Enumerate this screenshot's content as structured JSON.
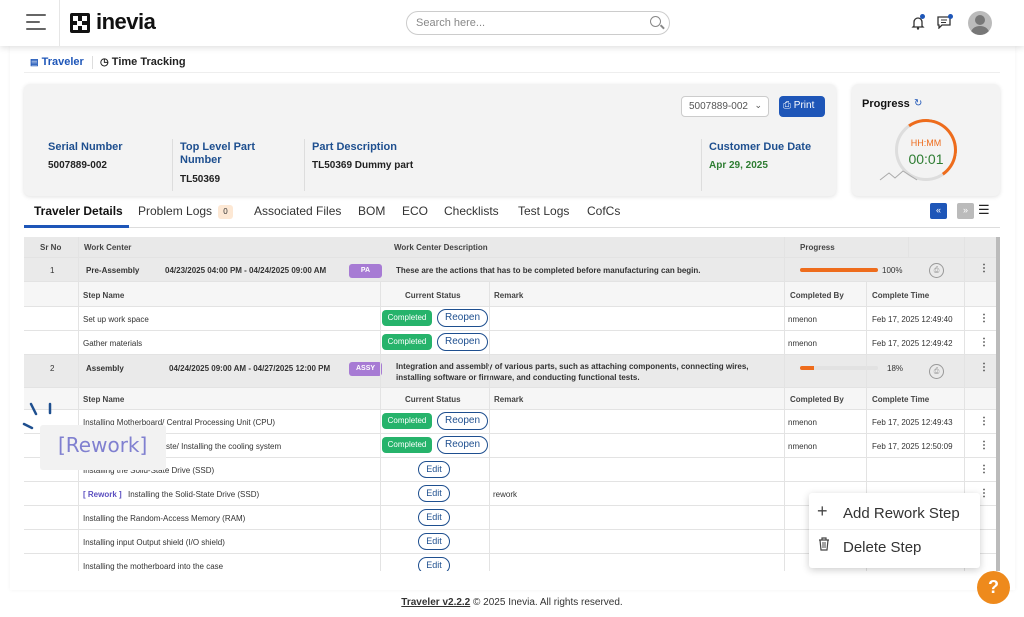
{
  "header": {
    "logo": "inevia",
    "search_placeholder": "Search here..."
  },
  "subtabs": [
    "Traveler",
    "Time Tracking"
  ],
  "info": {
    "serial_label": "Serial Number",
    "serial_value": "5007889-002",
    "tlp_label_1": "Top Level Part",
    "tlp_label_2": "Number",
    "tlp_value": "TL50369",
    "desc_label": "Part Description",
    "desc_value": "TL50369 Dummy part",
    "due_label": "Customer Due Date",
    "due_value": "Apr 29, 2025",
    "select_value": "5007889-002",
    "print_label": "Print"
  },
  "progress_card": {
    "title": "Progress",
    "unit": "HH:MM",
    "time": "00:01"
  },
  "tabs": [
    "Traveler Details",
    "Problem Logs",
    "Associated Files",
    "BOM",
    "ECO",
    "Checklists",
    "Test Logs",
    "CofCs"
  ],
  "problem_logs_count": "0",
  "table": {
    "headers": [
      "Sr No",
      "Work Center",
      "Work Center Description",
      "Progress"
    ],
    "step_headers": [
      "Step Name",
      "Current Status",
      "Remark",
      "Completed By",
      "Complete Time"
    ],
    "groups": [
      {
        "sr": "1",
        "name": "Pre-Assembly",
        "range": "04/23/2025 04:00 PM - 04/24/2025 09:00 AM",
        "tag": "PA",
        "desc": "These are the actions that has to be completed before manufacturing can begin.",
        "progress": 100,
        "progress_label": "100%"
      },
      {
        "sr": "2",
        "name": "Assembly",
        "range": "04/24/2025 09:00 AM - 04/27/2025 12:00 PM",
        "tag": "ASSY",
        "desc1": "Integration and assembly of various parts, such as attaching components, connecting wires,",
        "desc2": "installing software or firmware, and conducting functional tests.",
        "progress": 18,
        "progress_label": "18%"
      }
    ],
    "steps1": [
      {
        "name": "Set up work space",
        "status": "Completed",
        "action": "Reopen",
        "by": "nmenon",
        "time": "Feb 17, 2025 12:49:40"
      },
      {
        "name": "Gather materials",
        "status": "Completed",
        "action": "Reopen",
        "by": "nmenon",
        "time": "Feb 17, 2025 12:49:42"
      }
    ],
    "steps2": [
      {
        "name": "Installing Motherboard/ Central Processing Unit (CPU)",
        "status": "Completed",
        "action": "Reopen",
        "by": "nmenon",
        "time": "Feb 17, 2025 12:49:43"
      },
      {
        "name": "ste/ Installing the cooling system",
        "status": "Completed",
        "action": "Reopen",
        "by": "nmenon",
        "time": "Feb 17, 2025 12:50:09"
      },
      {
        "name": "Installing the Solid-State Drive (SSD)",
        "action": "Edit"
      },
      {
        "rework": "[ Rework ]",
        "name": "Installing the Solid-State Drive (SSD)",
        "action": "Edit",
        "remark": "rework"
      },
      {
        "name": "Installing the Random-Access Memory (RAM)",
        "action": "Edit"
      },
      {
        "name": "Installing input Output shield (I/O shield)",
        "action": "Edit"
      },
      {
        "name": "Installing the motherboard into the case",
        "action": "Edit"
      }
    ]
  },
  "context_menu": {
    "add": "Add Rework Step",
    "delete": "Delete Step"
  },
  "rework_overlay": "[Rework]",
  "footer": {
    "version": "Traveler v2.2.2",
    "copyright": "© 2025 Inevia. All rights reserved."
  },
  "help": "?",
  "colors": {
    "primary": "#1e56b8",
    "success": "#26b36b",
    "accent": "#ee6c1c",
    "tag": "#a77bd4"
  }
}
